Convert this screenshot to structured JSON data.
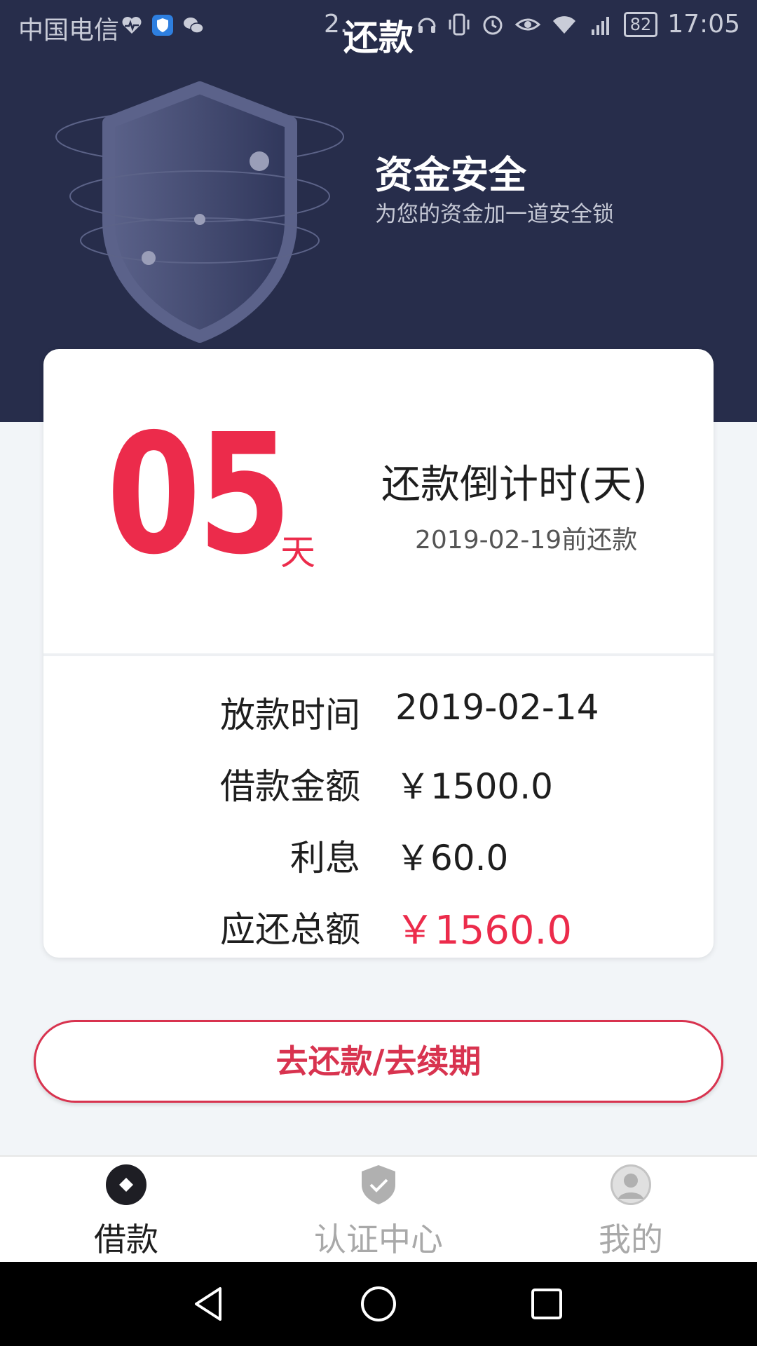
{
  "status_bar": {
    "carrier": "中国电信",
    "speed": "2.",
    "battery": "82",
    "time": "17:05",
    "icons": [
      "heartbeat-icon",
      "shield-app-icon",
      "wechat-icon",
      "headset-icon",
      "vibrate-icon",
      "alarm-icon",
      "eye-icon",
      "wifi-icon",
      "signal-4g-icon"
    ]
  },
  "header": {
    "title": "还款",
    "promo_title": "资金安全",
    "promo_subtitle": "为您的资金加一道安全锁",
    "background_color": "#272d4b"
  },
  "countdown": {
    "days": "05",
    "unit": "天",
    "label": "还款倒计时(天)",
    "due_date_text": "2019-02-19前还款",
    "accent_color": "#ec2b4b"
  },
  "details": [
    {
      "label": "放款时间",
      "value": "2019-02-14"
    },
    {
      "label": "借款金额",
      "value": "￥1500.0"
    },
    {
      "label": "利息",
      "value": "￥60.0"
    },
    {
      "label": "应还总额",
      "value": "￥1560.0"
    }
  ],
  "actions": {
    "repay_label": "去还款/去续期"
  },
  "tabs": [
    {
      "label": "借款",
      "icon": "loan-icon",
      "active": true
    },
    {
      "label": "认证中心",
      "icon": "shield-check-icon",
      "active": false
    },
    {
      "label": "我的",
      "icon": "user-icon",
      "active": false
    }
  ],
  "nav": [
    "back-icon",
    "home-icon",
    "recents-icon"
  ]
}
